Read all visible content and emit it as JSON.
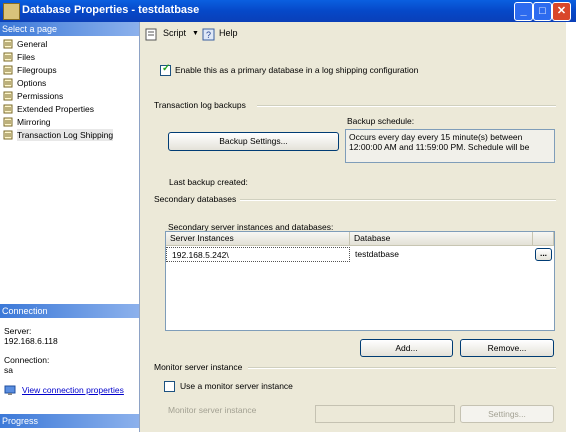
{
  "window": {
    "title": "Database Properties - testdatbase"
  },
  "left": {
    "select_page_header": "Select a page",
    "pages": [
      {
        "label": "General",
        "icon": "page-icon"
      },
      {
        "label": "Files",
        "icon": "page-icon"
      },
      {
        "label": "Filegroups",
        "icon": "page-icon"
      },
      {
        "label": "Options",
        "icon": "page-icon"
      },
      {
        "label": "Permissions",
        "icon": "page-icon"
      },
      {
        "label": "Extended Properties",
        "icon": "page-icon"
      },
      {
        "label": "Mirroring",
        "icon": "page-icon"
      },
      {
        "label": "Transaction Log Shipping",
        "icon": "page-icon"
      }
    ],
    "connection_header": "Connection",
    "server_label": "Server:",
    "server_value": "192.168.6.118",
    "connection_label": "Connection:",
    "connection_value": "sa",
    "view_props_link": "View connection properties",
    "progress_header": "Progress"
  },
  "toolbar": {
    "script_label": "Script",
    "help_label": "Help"
  },
  "main": {
    "enable_primary_label": "Enable this as a primary database in a log shipping configuration",
    "enable_primary_checked": true,
    "tlog_section": "Transaction log backups",
    "backup_schedule_label": "Backup schedule:",
    "backup_settings_button": "Backup Settings...",
    "schedule_text_1": "Occurs every day every 15 minute(s) between",
    "schedule_text_2": "12:00:00 AM and 11:59:00 PM. Schedule will be",
    "last_backup_label": "Last backup created:",
    "secondary_section": "Secondary databases",
    "secondary_instances_label": "Secondary server instances and databases:",
    "grid": {
      "columns": [
        "Server Instances",
        "Database"
      ],
      "rows": [
        {
          "server": "192.168.5.242\\",
          "database": "testdatbase"
        }
      ],
      "browse_button": "..."
    },
    "add_button": "Add...",
    "remove_button": "Remove...",
    "monitor_section": "Monitor server instance",
    "use_monitor_label": "Use a monitor server instance",
    "use_monitor_checked": false,
    "monitor_instance_label": "Monitor server instance",
    "monitor_settings_button": "Settings..."
  }
}
